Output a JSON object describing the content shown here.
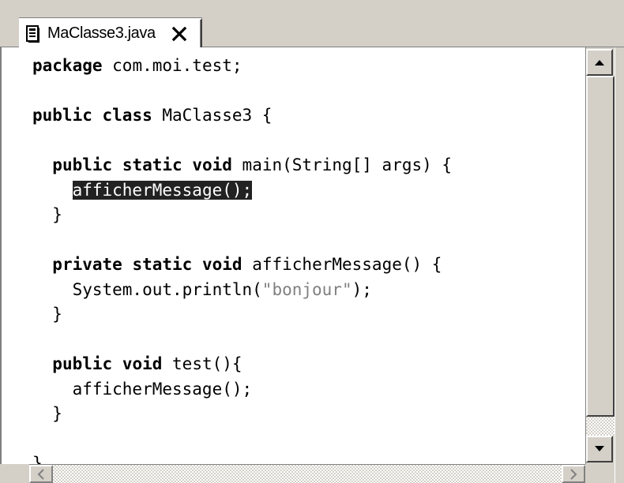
{
  "tab": {
    "title": "MaClasse3.java",
    "close_glyph": "X",
    "icon": "java-file-icon"
  },
  "code": {
    "lines": [
      [
        "package",
        " com.moi.test;"
      ],
      [
        ""
      ],
      [
        "public",
        " ",
        "class",
        " MaClasse3 {"
      ],
      [
        ""
      ],
      [
        "  ",
        "public",
        " ",
        "static",
        " ",
        "void",
        " main(String[] args) {"
      ],
      [
        "    ",
        "afficherMessage();"
      ],
      [
        "  }"
      ],
      [
        ""
      ],
      [
        "  ",
        "private",
        " ",
        "static",
        " ",
        "void",
        " afficherMessage() {"
      ],
      [
        "    System.out.println(",
        "\"bonjour\"",
        ");"
      ],
      [
        "  }"
      ],
      [
        ""
      ],
      [
        "  ",
        "public",
        " ",
        "void",
        " test(){"
      ],
      [
        "    afficherMessage();"
      ],
      [
        "  }"
      ],
      [
        ""
      ],
      [
        "}"
      ]
    ],
    "selected_text": "afficherMessage();"
  },
  "scrollbars": {
    "up_arrow": "scroll-up-arrow-icon",
    "down_arrow": "scroll-down-arrow-icon",
    "left_arrow": "scroll-left-arrow-icon",
    "right_arrow": "scroll-right-arrow-icon"
  },
  "colors": {
    "selection_bg": "#222222",
    "string_literal": "#808080",
    "chrome": "#d4d0c8"
  }
}
